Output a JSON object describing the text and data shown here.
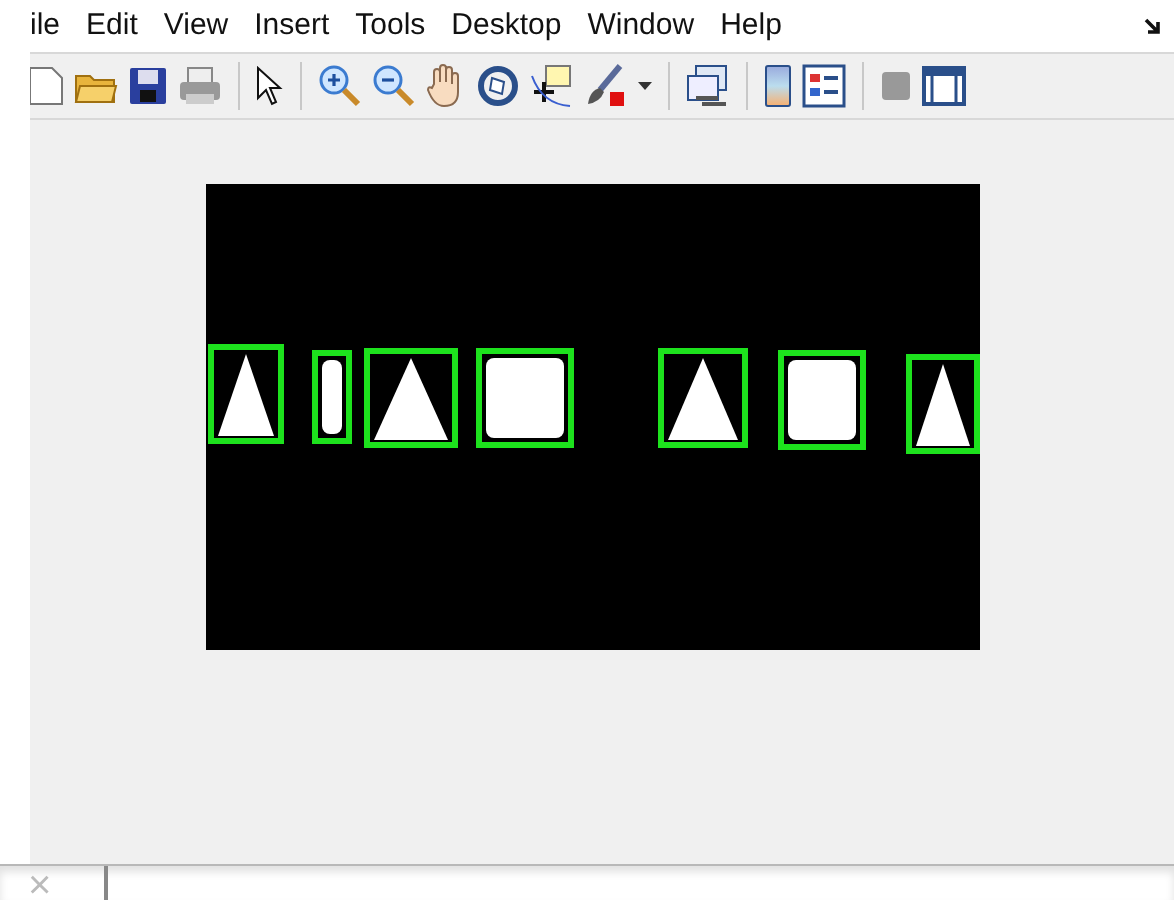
{
  "menu": [
    {
      "label": "ile"
    },
    {
      "label": "Edit"
    },
    {
      "label": "View"
    },
    {
      "label": "Insert"
    },
    {
      "label": "Tools"
    },
    {
      "label": "Desktop"
    },
    {
      "label": "Window"
    },
    {
      "label": "Help"
    }
  ],
  "command_bar": {
    "close_glyph": "×"
  }
}
